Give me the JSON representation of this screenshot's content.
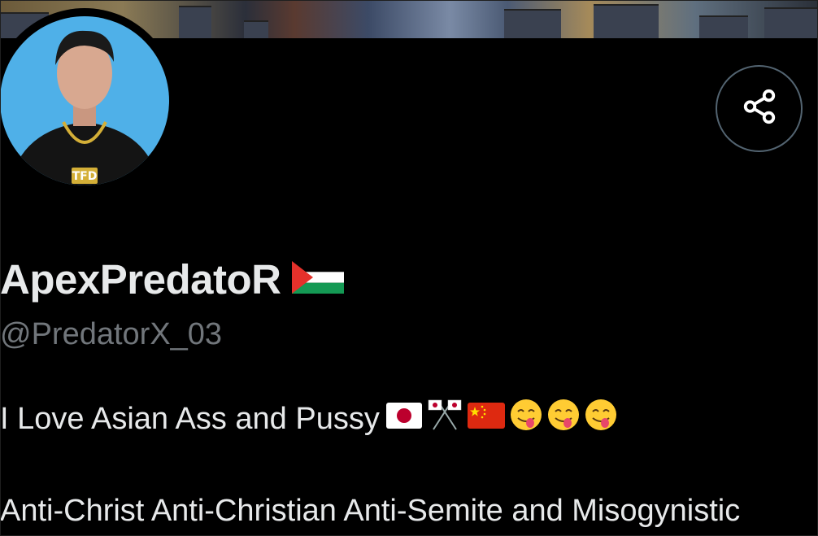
{
  "profile": {
    "display_name": "ApexPredatoR",
    "name_flag": "palestine-flag-icon",
    "handle": "@PredatorX_03",
    "avatar_text": "TFD",
    "bio_line1": "I Love Asian Ass and Pussy",
    "bio_line1_emojis": [
      "japan-flag-icon",
      "crossed-flags-icon",
      "china-flag-icon",
      "yum-face-icon",
      "yum-face-icon",
      "yum-face-icon"
    ],
    "bio_line2": "Anti-Christ Anti-Christian Anti-Semite and Misogynistic"
  },
  "actions": {
    "share_icon": "share-icon"
  },
  "colors": {
    "background": "#000000",
    "text": "#e7e9ea",
    "muted": "#71767b",
    "border": "#536471",
    "avatar_bg": "#4fb0e8"
  }
}
